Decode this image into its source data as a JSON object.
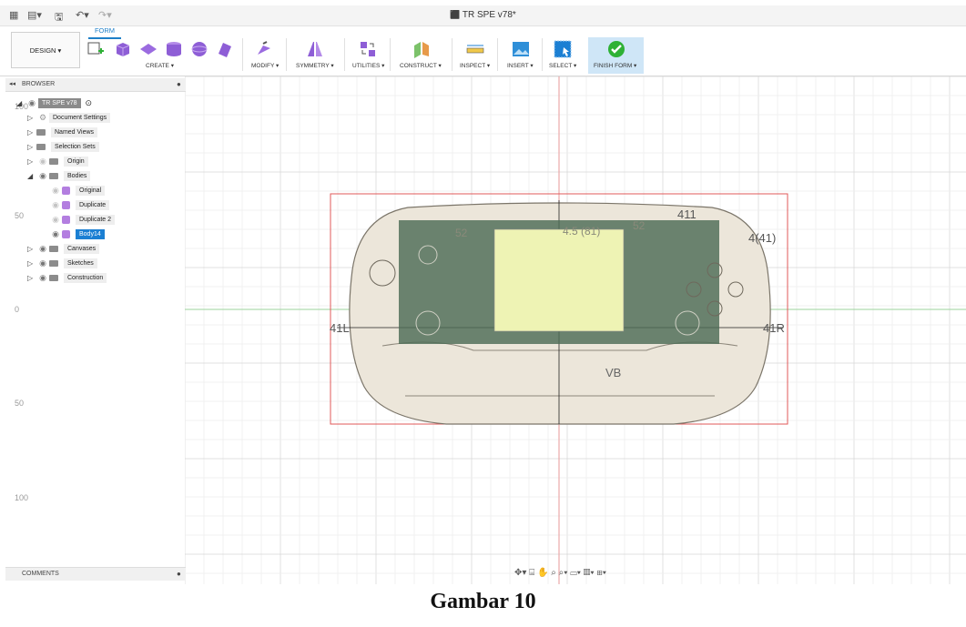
{
  "window": {
    "title": "TR SPE v78*"
  },
  "toolbar": {
    "design_label": "DESIGN ▾",
    "active_tab": "FORM",
    "groups": [
      "CREATE ▾",
      "MODIFY ▾",
      "SYMMETRY ▾",
      "UTILITIES ▾",
      "CONSTRUCT ▾",
      "INSPECT ▾",
      "INSERT ▾",
      "SELECT ▾",
      "FINISH FORM ▾"
    ]
  },
  "browser": {
    "header": "BROWSER",
    "root": "TR SPE v78",
    "items": [
      {
        "label": "Document Settings"
      },
      {
        "label": "Named Views"
      },
      {
        "label": "Selection Sets"
      },
      {
        "label": "Origin"
      },
      {
        "label": "Bodies"
      },
      {
        "label": "Original"
      },
      {
        "label": "Duplicate"
      },
      {
        "label": "Duplicate 2"
      },
      {
        "label": "Body14",
        "selected": true
      },
      {
        "label": "Canvases"
      },
      {
        "label": "Sketches"
      },
      {
        "label": "Construction"
      }
    ]
  },
  "comments": {
    "header": "COMMENTS"
  },
  "viewport": {
    "axis_labels": [
      "100",
      "50",
      "0",
      "50",
      "100"
    ],
    "sketch_dims": [
      "41L",
      "41R",
      "4(41)",
      "411",
      "VB",
      "4.5 (81)",
      "52",
      "52"
    ]
  },
  "caption": "Gambar 10",
  "colors": {
    "accent": "#1b7fd3",
    "finish": "#2eb135",
    "grid": "#e6e6e6",
    "body": "#ece6da",
    "pcb": "#4d6b56",
    "screen": "#eef3b4",
    "crop": "#e05858"
  }
}
